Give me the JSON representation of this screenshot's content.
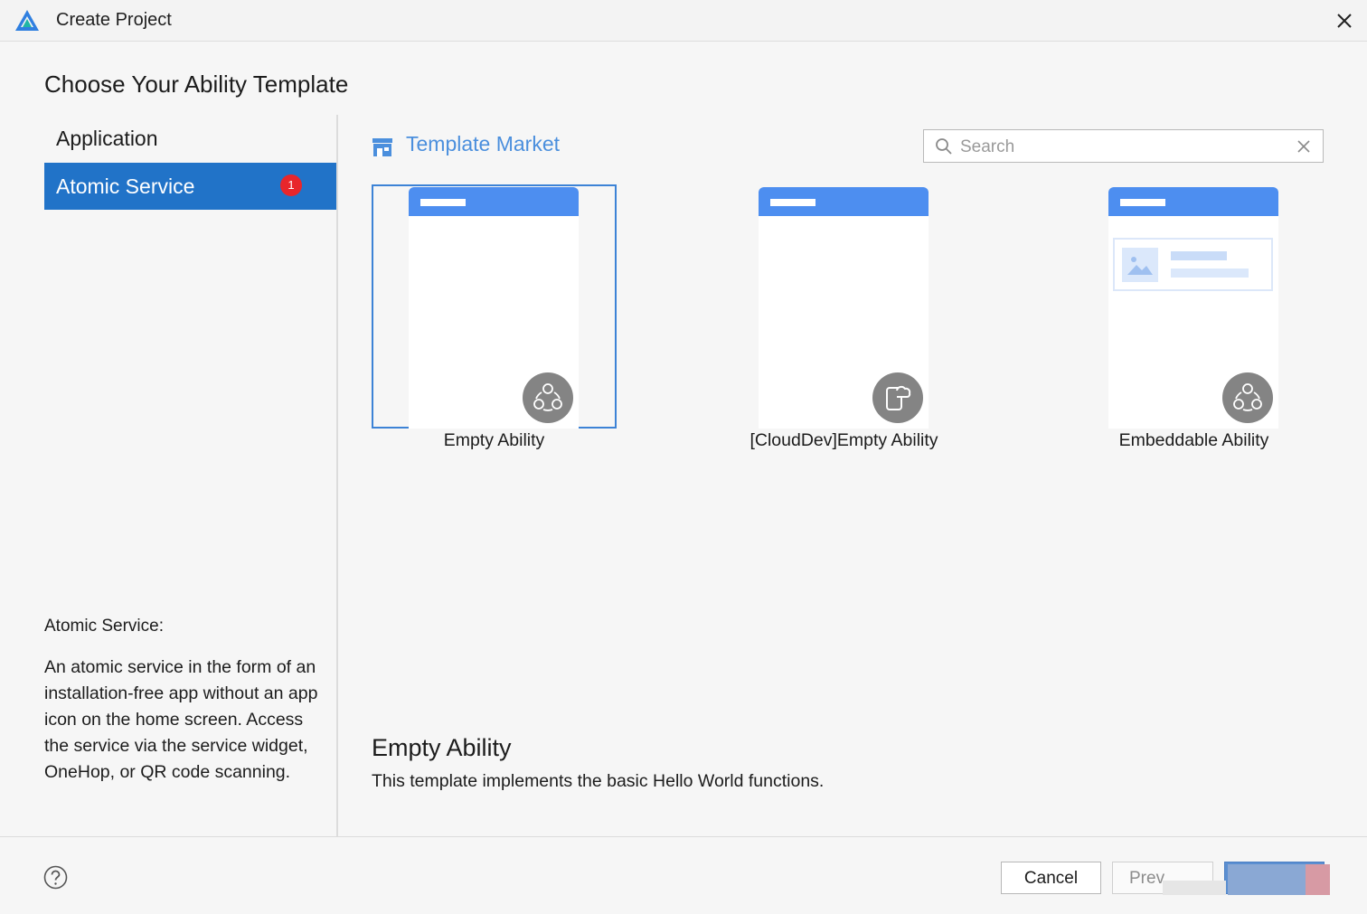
{
  "window": {
    "title": "Create Project"
  },
  "page": {
    "title": "Choose Your Ability Template"
  },
  "sidebar": {
    "items": [
      {
        "label": "Application",
        "selected": false
      },
      {
        "label": "Atomic Service",
        "selected": true,
        "badge": "1"
      }
    ],
    "description_title": "Atomic Service:",
    "description": "An atomic service in the form of an installation-free app without an app icon on the home screen. Access the service via the service widget, OneHop, or QR code scanning."
  },
  "market": {
    "label": "Template Market",
    "icon": "store-icon"
  },
  "search": {
    "placeholder": "Search",
    "value": ""
  },
  "templates": [
    {
      "label": "Empty Ability",
      "icon": "atomic-service-icon",
      "selected": true
    },
    {
      "label": "[CloudDev]Empty Ability",
      "icon": "cloud-dev-icon",
      "selected": false
    },
    {
      "label": "Embeddable Ability",
      "icon": "atomic-service-icon",
      "selected": false
    }
  ],
  "detail": {
    "title": "Empty Ability",
    "description": "This template implements the basic Hello World functions."
  },
  "footer": {
    "cancel_label": "Cancel",
    "prev_label": "Prev",
    "next_label": ""
  },
  "colors": {
    "accent": "#2173c8",
    "market_link": "#4b8fdd",
    "template_bar": "#4d8ef0",
    "badge": "#e8262b",
    "selection_border": "#3d83d6"
  }
}
